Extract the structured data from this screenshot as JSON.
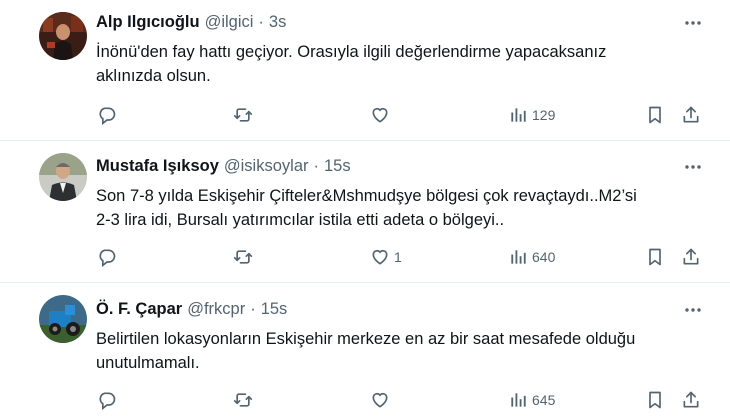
{
  "tweets": [
    {
      "name": "Alp Ilgıcıoğlu",
      "handle": "@ilgici",
      "separator": "·",
      "time": "3s",
      "text_lines": [
        "İnönü'den fay hattı geçiyor. Orasıyla ilgili değerlendirme yapacaksanız",
        "aklınızda olsun."
      ],
      "likes": "",
      "views": "129"
    },
    {
      "name": "Mustafa Işıksoy",
      "handle": "@isiksoylar",
      "separator": "·",
      "time": "15s",
      "text_lines": [
        "Son 7-8 yılda Eskişehir Çifteler&Mshmudşye bölgesi çok revaçtaydı..M2’si",
        "2-3 lira idi, Bursalı yatırımcılar istila etti adeta o bölgeyi.."
      ],
      "likes": "1",
      "views": "640"
    },
    {
      "name": "Ö. F. Çapar",
      "handle": "@frkcpr",
      "separator": "·",
      "time": "15s",
      "text_lines": [
        "Belirtilen lokasyonların Eskişehir merkeze en az bir saat mesafede olduğu",
        "unutulmamalı."
      ],
      "likes": "",
      "views": "645"
    }
  ],
  "colors": {
    "text": "#0f1419",
    "secondary": "#536471",
    "divider": "#e6ecf0"
  },
  "icons": [
    "reply-icon",
    "retweet-icon",
    "like-icon",
    "views-icon",
    "bookmark-icon",
    "share-icon",
    "more-icon"
  ]
}
